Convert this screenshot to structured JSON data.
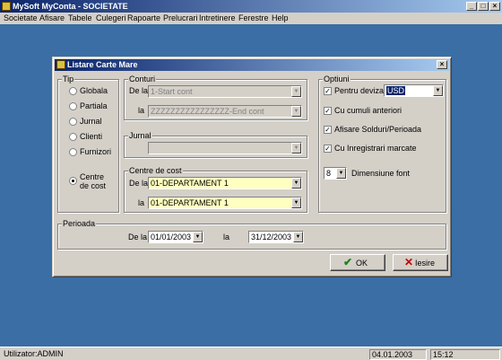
{
  "app": {
    "title": "MySoft MyConta - SOCIETATE",
    "minimize": "_",
    "maximize": "□",
    "close": "×"
  },
  "menu": [
    "Societate",
    "Afisare",
    "Tabele",
    "Culegeri",
    "Rapoarte",
    "Prelucrari",
    "Intretinere",
    "Ferestre",
    "Help"
  ],
  "status": {
    "user": "Utilizator:ADMIN",
    "date": "04.01.2003",
    "time": "15:12"
  },
  "dialog": {
    "title": "Listare Carte Mare",
    "close": "×",
    "tip": {
      "label": "Tip",
      "options": [
        "Globala",
        "Partiala",
        "Jurnal",
        "Clienti",
        "Furnizori"
      ],
      "centre_line1": "Centre",
      "centre_line2": "de cost",
      "selected": "Centre de cost"
    },
    "conturi": {
      "label": "Conturi",
      "de_la_label": "De la",
      "de_la_value": "1-Start cont",
      "la_label": "la",
      "la_value": "ZZZZZZZZZZZZZZZZ-End cont"
    },
    "jurnal": {
      "label": "Jurnal",
      "value": ""
    },
    "centre_cost": {
      "label": "Centre de cost",
      "de_la_label": "De la",
      "de_la_value": "01-DEPARTAMENT 1",
      "la_label": "la",
      "la_value": "01-DEPARTAMENT 1"
    },
    "optiuni": {
      "label": "Optiuni",
      "pentru_deviza": "Pentru deviza",
      "deviza_value": "USD",
      "cu_cumuli": "Cu cumuli anteriori",
      "afisare_solduri": "Afisare Solduri/Perioada",
      "cu_inregistrari": "Cu Inregistrari marcate",
      "checked": "✓",
      "dimensiune_value": "8",
      "dimensiune_label": "Dimensiune font"
    },
    "perioada": {
      "label": "Perioada",
      "de_la_label": "De la",
      "de_la_value": "01/01/2003",
      "la_label": "la",
      "la_value": "31/12/2003"
    },
    "ok_label": "OK",
    "iesire_label": "Iesire"
  }
}
